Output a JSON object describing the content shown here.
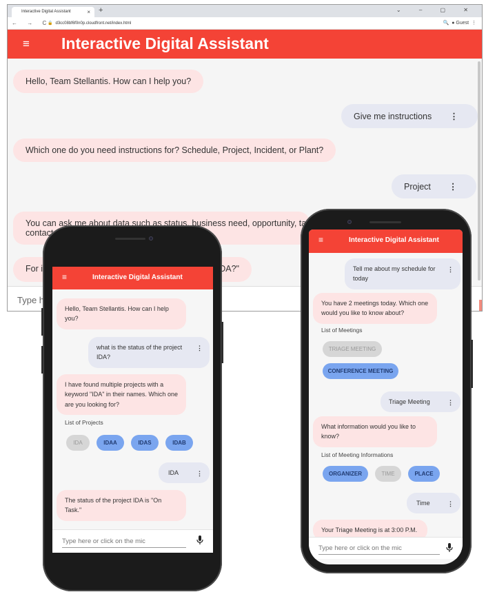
{
  "browser": {
    "tab_title": "Interactive Digital Assistant",
    "tab_close": "×",
    "new_tab": "+",
    "window_controls": "⌄ – ▢ ✕",
    "nav": "← → C",
    "url": "d3cc08bf6f0n0p.cloudfront.net/index.html",
    "profile": "Guest",
    "app_title": "Interactive Digital Assistant",
    "messages": [
      {
        "role": "bot",
        "text": "Hello, Team Stellantis. How can I help you?"
      },
      {
        "role": "user",
        "text": "Give me instructions"
      },
      {
        "role": "bot",
        "text": "Which one do you need instructions for? Schedule, Project, Incident, or Plant?"
      },
      {
        "role": "user",
        "text": "Project"
      },
      {
        "role": "bot",
        "text": "You can ask me about data such as status, business need, opportunity, tar"
      },
      {
        "role": "bot",
        "text": "contact"
      },
      {
        "role": "bot",
        "text": "For i"
      },
      {
        "role": "bot",
        "text": "DA?\""
      }
    ],
    "input_placeholder": "Type h"
  },
  "phone_left": {
    "app_title": "Interactive Digital Assistant",
    "messages": [
      {
        "role": "bot",
        "text": "Hello, Team Stellantis. How can I help you?"
      },
      {
        "role": "user",
        "text": "what is the status of the project IDA?"
      },
      {
        "role": "bot",
        "text": "I have found multiple projects with a keyword \"IDA\" in their names. Which one are you looking for?"
      },
      {
        "role": "user",
        "text": "IDA"
      },
      {
        "role": "bot",
        "text": "The status of the project IDA is \"On Task.\""
      }
    ],
    "list_label": "List of Projects",
    "chips": [
      "IDA",
      "IDAA",
      "IDAS",
      "IDAB"
    ],
    "input_placeholder": "Type here or click on the mic"
  },
  "phone_right": {
    "app_title": "Interactive Digital Assistant",
    "messages": [
      {
        "role": "user",
        "text": "Tell me about my schedule for today"
      },
      {
        "role": "bot",
        "text": "You have 2 meetings today. Which one would you like to know about?"
      },
      {
        "role": "user",
        "text": "Triage Meeting"
      },
      {
        "role": "bot",
        "text": "What information would you like to know?"
      },
      {
        "role": "user",
        "text": "Time"
      },
      {
        "role": "bot",
        "text": "Your Triage Meeting is at 3:00 P.M."
      }
    ],
    "meetings_label": "List of Meetings",
    "meeting_chips": [
      "TRIAGE MEETING",
      "CONFERENCE MEETING"
    ],
    "info_label": "List of Meeting Informations",
    "info_chips": [
      "ORGANIZER",
      "TIME",
      "PLACE"
    ],
    "input_placeholder": "Type here or click on the mic"
  },
  "icons": {
    "menu": "≡",
    "kebab": "⋮",
    "mic": "🎤"
  },
  "colors": {
    "app_bar": "#f44336",
    "bot_bubble": "#fde4e4",
    "user_bubble": "#e6e8f2",
    "chip_active": "#7aa5ef",
    "chip_inactive": "#d6d6d6"
  }
}
